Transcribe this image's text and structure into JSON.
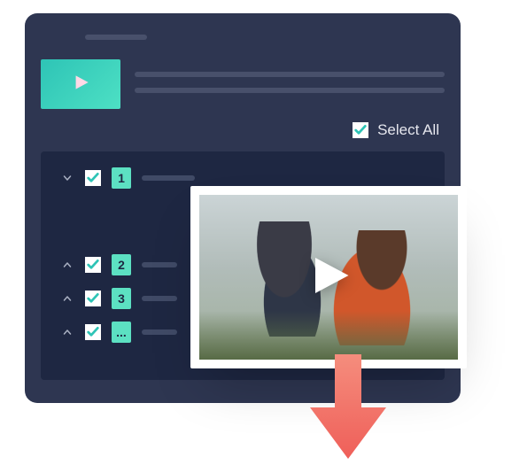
{
  "selectAll": {
    "label": "Select All",
    "checked": true
  },
  "tree": [
    {
      "expanded": true,
      "checked": true,
      "badge": "1"
    },
    {
      "expanded": false,
      "checked": true,
      "badge": "2"
    },
    {
      "expanded": false,
      "checked": true,
      "badge": "3"
    },
    {
      "expanded": false,
      "checked": true,
      "badge": "..."
    }
  ],
  "colors": {
    "panel": "#2e3651",
    "listBg": "#1e2742",
    "accent": "#5ce0c2",
    "dot": "#1e9be8",
    "arrow": "#f47769"
  }
}
